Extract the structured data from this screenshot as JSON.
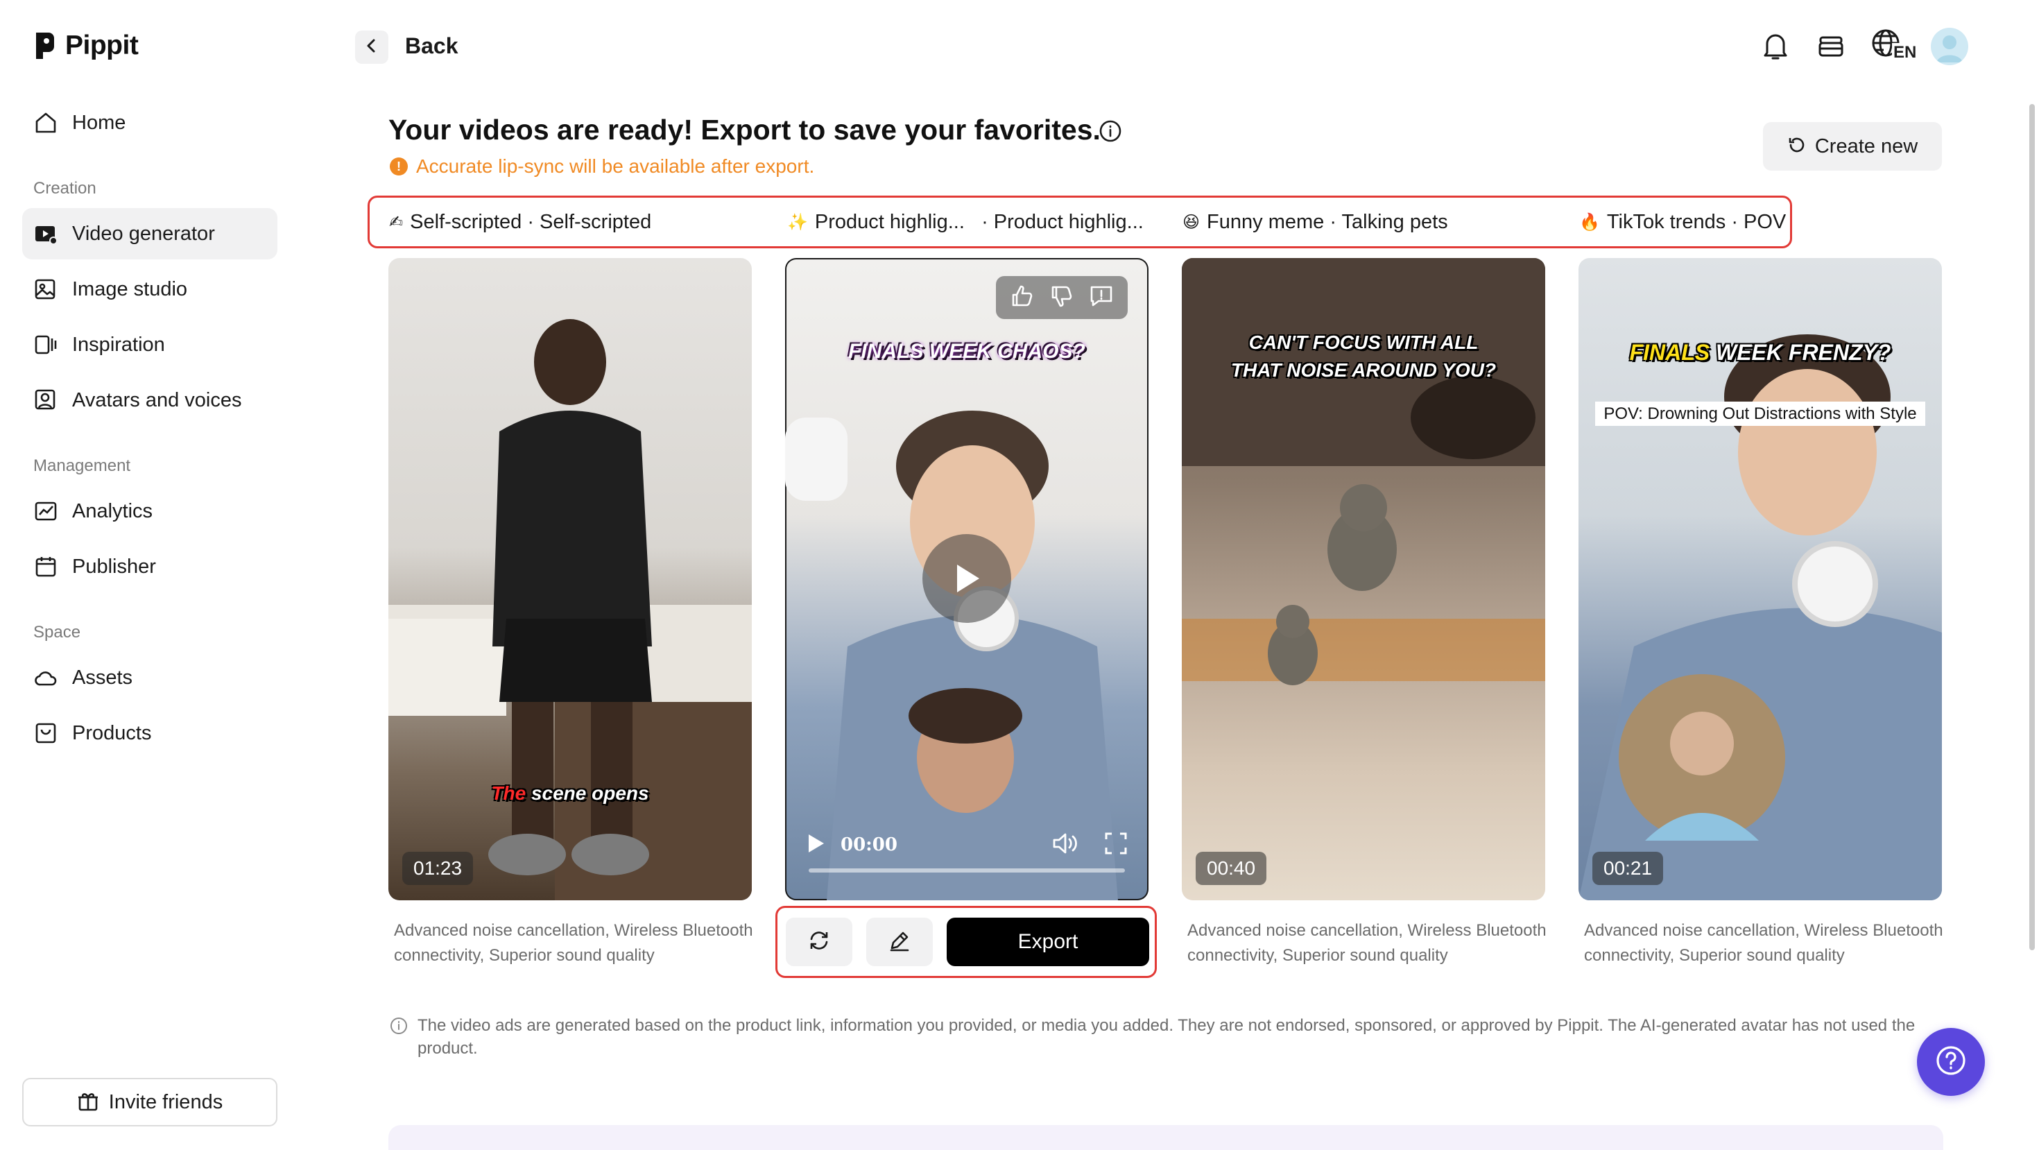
{
  "app": {
    "name": "Pippit"
  },
  "sidebar": {
    "home": "Home",
    "sections": {
      "creation": "Creation",
      "management": "Management",
      "space": "Space"
    },
    "items": [
      {
        "label": "Video generator",
        "icon": "video-generator-icon"
      },
      {
        "label": "Image studio",
        "icon": "image-studio-icon"
      },
      {
        "label": "Inspiration",
        "icon": "inspiration-icon"
      },
      {
        "label": "Avatars and voices",
        "icon": "avatar-icon"
      },
      {
        "label": "Analytics",
        "icon": "analytics-icon"
      },
      {
        "label": "Publisher",
        "icon": "calendar-icon"
      },
      {
        "label": "Assets",
        "icon": "cloud-icon"
      },
      {
        "label": "Products",
        "icon": "product-icon"
      }
    ],
    "invite": "Invite friends"
  },
  "topbar": {
    "back": "Back",
    "language": "EN"
  },
  "header": {
    "title": "Your videos are ready! Export to save your favorites.",
    "notice": "Accurate lip-sync will be available after export.",
    "create_new": "Create new"
  },
  "tags": [
    {
      "emoji": "✍",
      "label": "Self-scripted · Self-scripted"
    },
    {
      "emoji": "✨",
      "label": "Product highlig...   · Product highlig..."
    },
    {
      "emoji": "😆",
      "label": "Funny meme · Talking pets"
    },
    {
      "emoji": "🔥",
      "label": "TikTok trends · POV"
    }
  ],
  "videos": [
    {
      "duration": "01:23",
      "caption_red": "The",
      "caption": " scene opens",
      "description": "Advanced noise cancellation, Wireless Bluetooth connectivity, Superior sound quality"
    },
    {
      "caption": "FINALS WEEK CHAOS?",
      "time": "00:00",
      "progress": 0,
      "description": ""
    },
    {
      "duration": "00:40",
      "caption": "CAN'T FOCUS WITH ALL THAT NOISE AROUND YOU?",
      "description": "Advanced noise cancellation, Wireless Bluetooth connectivity, Superior sound quality"
    },
    {
      "duration": "00:21",
      "caption_yellow": "FINALS",
      "caption": " WEEK FRENZY?",
      "subtitle": "POV: Drowning Out Distractions with Style",
      "description": "Advanced noise cancellation, Wireless Bluetooth connectivity, Superior sound quality"
    }
  ],
  "actions": {
    "export": "Export"
  },
  "disclaimer": "The video ads are generated based on the product link, information you provided, or media you added. They are not endorsed, sponsored, or approved by Pippit. The AI-generated avatar has not used the product.",
  "colors": {
    "accent": "#5b47dd",
    "highlight_border": "#e23a36",
    "warning": "#f08a24"
  }
}
